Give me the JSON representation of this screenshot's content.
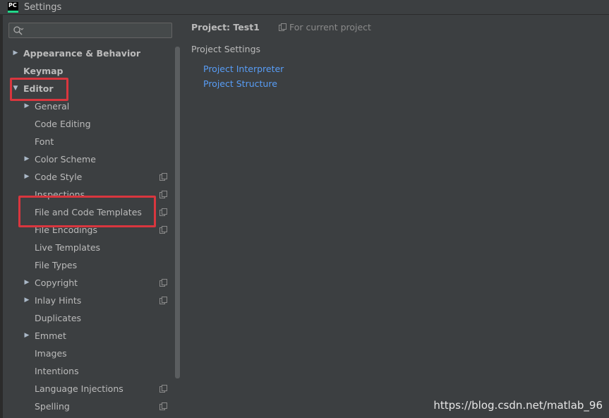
{
  "window": {
    "title": "Settings",
    "app_icon_text": "PC"
  },
  "search": {
    "placeholder": "",
    "value": ""
  },
  "tree": [
    {
      "label": "Appearance & Behavior",
      "bold": true,
      "arrow": "right",
      "indent": 0
    },
    {
      "label": "Keymap",
      "bold": true,
      "arrow": "none",
      "indent": 0
    },
    {
      "label": "Editor",
      "bold": true,
      "arrow": "down",
      "indent": 0
    },
    {
      "label": "General",
      "bold": false,
      "arrow": "right",
      "indent": 1
    },
    {
      "label": "Code Editing",
      "bold": false,
      "arrow": "none",
      "indent": 1
    },
    {
      "label": "Font",
      "bold": false,
      "arrow": "none",
      "indent": 1
    },
    {
      "label": "Color Scheme",
      "bold": false,
      "arrow": "right",
      "indent": 1
    },
    {
      "label": "Code Style",
      "bold": false,
      "arrow": "right",
      "indent": 1,
      "copy_icon": true
    },
    {
      "label": "Inspections",
      "bold": false,
      "arrow": "none",
      "indent": 1,
      "copy_icon": true
    },
    {
      "label": "File and Code Templates",
      "bold": false,
      "arrow": "none",
      "indent": 1,
      "copy_icon": true
    },
    {
      "label": "File Encodings",
      "bold": false,
      "arrow": "none",
      "indent": 1,
      "copy_icon": true
    },
    {
      "label": "Live Templates",
      "bold": false,
      "arrow": "none",
      "indent": 1
    },
    {
      "label": "File Types",
      "bold": false,
      "arrow": "none",
      "indent": 1
    },
    {
      "label": "Copyright",
      "bold": false,
      "arrow": "right",
      "indent": 1,
      "copy_icon": true
    },
    {
      "label": "Inlay Hints",
      "bold": false,
      "arrow": "right",
      "indent": 1,
      "copy_icon": true
    },
    {
      "label": "Duplicates",
      "bold": false,
      "arrow": "none",
      "indent": 1
    },
    {
      "label": "Emmet",
      "bold": false,
      "arrow": "right",
      "indent": 1
    },
    {
      "label": "Images",
      "bold": false,
      "arrow": "none",
      "indent": 1
    },
    {
      "label": "Intentions",
      "bold": false,
      "arrow": "none",
      "indent": 1
    },
    {
      "label": "Language Injections",
      "bold": false,
      "arrow": "none",
      "indent": 1,
      "copy_icon": true
    },
    {
      "label": "Spelling",
      "bold": false,
      "arrow": "none",
      "indent": 1,
      "copy_icon": true
    }
  ],
  "content": {
    "project_title": "Project: Test1",
    "for_current_project": "For current project",
    "section_title": "Project Settings",
    "links": [
      "Project Interpreter",
      "Project Structure"
    ]
  },
  "watermark": "https://blog.csdn.net/matlab_96",
  "colors": {
    "background": "#3c3f41",
    "link": "#589df6",
    "highlight": "#d9363e",
    "text": "#bbbbbb"
  }
}
